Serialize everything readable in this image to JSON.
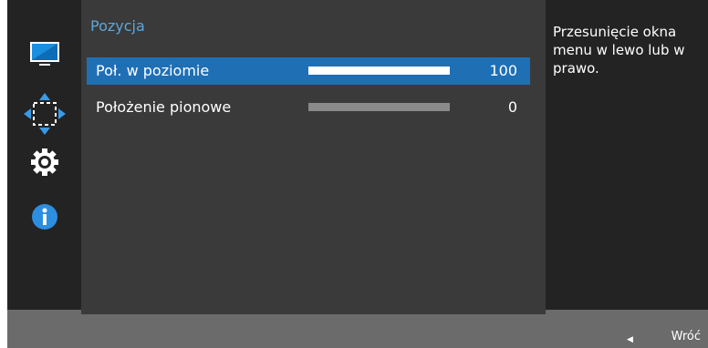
{
  "sidebar": {
    "items": [
      {
        "icon": "monitor-icon"
      },
      {
        "icon": "position-arrows-icon"
      },
      {
        "icon": "gear-icon"
      },
      {
        "icon": "info-icon"
      }
    ]
  },
  "main": {
    "title": "Pozycja",
    "rows": [
      {
        "label": "Poł. w poziomie",
        "value": "100",
        "level_percent": 100,
        "selected": true
      },
      {
        "label": "Położenie pionowe",
        "value": "0",
        "level_percent": 0,
        "selected": false
      }
    ]
  },
  "help": {
    "text": "Przesunięcie okna menu w lewo lub w prawo."
  },
  "footer": {
    "back_label": "Wróć",
    "back_icon": "left-arrow-icon"
  },
  "colors": {
    "accent": "#1f6fb5",
    "title": "#5fa6d8",
    "panel": "#3a3a3a",
    "sidebar": "#232323",
    "footer": "#6b6b6b"
  }
}
